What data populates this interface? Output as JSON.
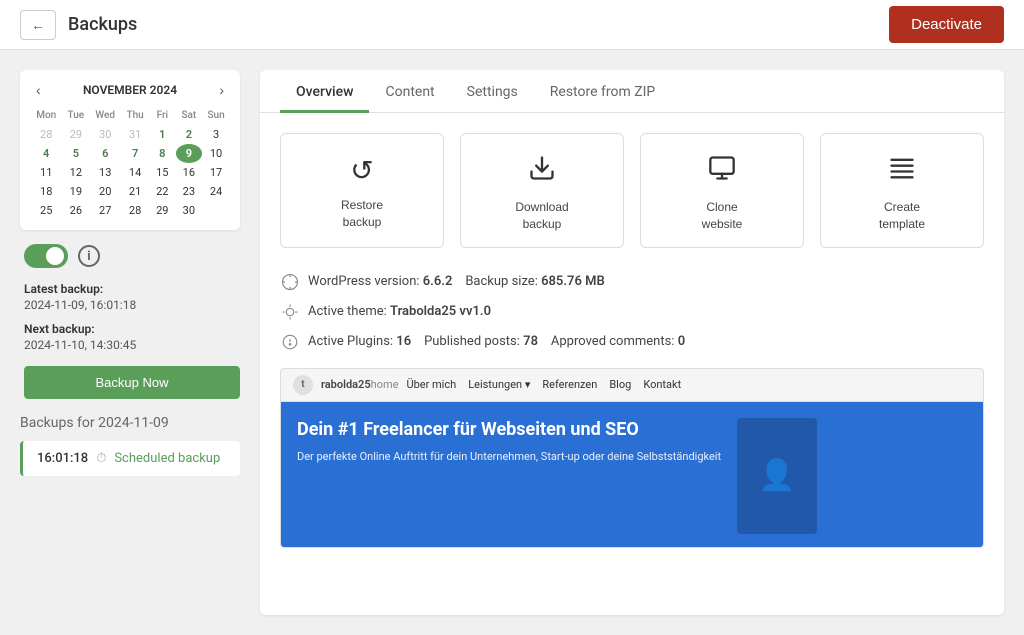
{
  "header": {
    "title": "Backups",
    "back_label": "←",
    "deactivate_label": "Deactivate"
  },
  "calendar": {
    "month": "NOVEMBER 2024",
    "days_header": [
      "Mon",
      "Tue",
      "Wed",
      "Thu",
      "Fri",
      "Sat",
      "Sun"
    ],
    "weeks": [
      [
        "28",
        "29",
        "30",
        "31",
        "1",
        "2",
        "3"
      ],
      [
        "4",
        "5",
        "6",
        "7",
        "8",
        "9",
        "10"
      ],
      [
        "11",
        "12",
        "13",
        "14",
        "15",
        "16",
        "17"
      ],
      [
        "18",
        "19",
        "20",
        "21",
        "22",
        "23",
        "24"
      ],
      [
        "25",
        "26",
        "27",
        "28",
        "29",
        "30",
        ""
      ]
    ],
    "other_month_week0": [
      true,
      true,
      true,
      true,
      false,
      false,
      false
    ],
    "selected_date": "9",
    "has_backup_dates": [
      "1",
      "2",
      "4",
      "5",
      "6",
      "7",
      "8",
      "9"
    ]
  },
  "backup_toggle": {
    "enabled": true
  },
  "backup_info": {
    "latest_label": "Latest backup:",
    "latest_value": "2024-11-09, 16:01:18",
    "next_label": "Next backup:",
    "next_value": "2024-11-10, 14:30:45",
    "backup_now_label": "Backup Now"
  },
  "backup_list": {
    "date_label": "Backups for 2024-11-09",
    "items": [
      {
        "time": "16:01:18",
        "type": "Scheduled backup"
      }
    ]
  },
  "tabs": {
    "items": [
      "Overview",
      "Content",
      "Settings",
      "Restore from ZIP"
    ],
    "active": 0
  },
  "actions": [
    {
      "id": "restore",
      "icon": "↺",
      "label": "Restore\nbackup"
    },
    {
      "id": "download",
      "icon": "⬇",
      "label": "Download\nbackup"
    },
    {
      "id": "clone",
      "icon": "🖥",
      "label": "Clone\nwebsite"
    },
    {
      "id": "template",
      "icon": "☰",
      "label": "Create\ntemplate"
    }
  ],
  "site_info": {
    "wp_version_label": "WordPress version:",
    "wp_version": "6.6.2",
    "backup_size_label": "Backup size:",
    "backup_size": "685.76 MB",
    "theme_label": "Active theme:",
    "theme": "Trabolda25 vv1.0",
    "plugins_label": "Active Plugins:",
    "plugins_count": "16",
    "posts_label": "Published posts:",
    "posts_count": "78",
    "comments_label": "Approved comments:",
    "comments_count": "0"
  },
  "preview": {
    "logo_text": "t",
    "brand": "rabolda25",
    "nav_links": [
      "Home",
      "Über mich",
      "Leistungen ▾",
      "Referenzen",
      "Blog",
      "Kontakt"
    ],
    "hero_heading": "Dein #1 Freelancer für Webseiten und SEO",
    "hero_subtext": "Der perfekte Online Auftritt für dein Unternehmen, Start-up oder deine Selbstständigkeit"
  }
}
